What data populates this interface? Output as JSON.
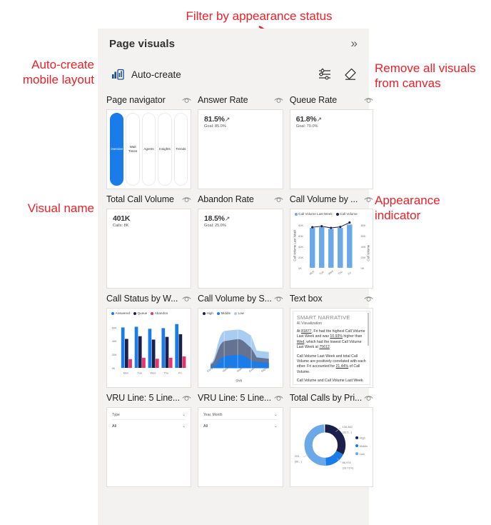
{
  "annotations": [
    {
      "id": "filter-note",
      "text": "Filter by appearance status"
    },
    {
      "id": "auto-create-note",
      "text": "Auto-create\nmobile layout"
    },
    {
      "id": "remove-visuals-note",
      "text": "Remove all visuals\nfrom canvas"
    },
    {
      "id": "visual-name-note",
      "text": "Visual name"
    },
    {
      "id": "appearance-note",
      "text": "Appearance\nindicator"
    }
  ],
  "pane": {
    "title": "Page visuals",
    "collapse_icon": "chevron-double-right-icon",
    "toolbar": {
      "auto_create_label": "Auto-create",
      "auto_create_icon": "mobile-chart-icon",
      "filter_icon": "filter-sliders-icon",
      "remove_icon": "eraser-icon"
    },
    "accent_color": "#1a7ce8",
    "annotation_color": "#ec2028",
    "panel_color": "#f3f2f1"
  },
  "visuals": [
    {
      "title": "Page navigator",
      "type": "page-navigator",
      "eye_icon": "eye-visible-icon",
      "tabs": [
        "Overview",
        "Wait Times",
        "Agents",
        "Insights",
        "Trends"
      ],
      "active_tab": "Overview"
    },
    {
      "title": "Answer Rate",
      "type": "kpi",
      "eye_icon": "eye-visible-icon",
      "value": "81.5%",
      "goal": "Goal: 85.0%"
    },
    {
      "title": "Queue Rate",
      "type": "kpi",
      "eye_icon": "eye-visible-icon",
      "value": "61.8%",
      "goal": "Goal: 70.0%"
    },
    {
      "title": "Total Call Volume",
      "type": "kpi",
      "eye_icon": "eye-visible-icon",
      "value": "401K",
      "goal": "Calls: 8K"
    },
    {
      "title": "Abandon Rate",
      "type": "kpi",
      "eye_icon": "eye-visible-icon",
      "value": "18.5%",
      "goal": "Goal: 25.0%"
    },
    {
      "title": "Call Volume by ...",
      "type": "combo",
      "eye_icon": "eye-visible-icon"
    },
    {
      "title": "Call Status by W...",
      "type": "clustered-column",
      "eye_icon": "eye-visible-icon"
    },
    {
      "title": "Call Volume by S...",
      "type": "stacked-area",
      "eye_icon": "eye-visible-icon"
    },
    {
      "title": "Text box",
      "type": "smart-narrative",
      "eye_icon": "eye-visible-icon"
    },
    {
      "title": "VRU Line: 5 Line...",
      "type": "slicer",
      "eye_icon": "eye-visible-icon",
      "field": "Type",
      "value": "All",
      "chevron_icon": "chevron-down-icon"
    },
    {
      "title": "VRU Line: 5 Line...",
      "type": "slicer",
      "eye_icon": "eye-visible-icon",
      "field": "Year, Month",
      "value": "All",
      "chevron_icon": "chevron-down-icon"
    },
    {
      "title": "Total Calls by Pri...",
      "type": "donut",
      "eye_icon": "eye-visible-icon"
    }
  ],
  "narrative": {
    "heading": "SMART NARRATIVE",
    "subheading": "AI Visualization",
    "p1_pre": "At ",
    "p1_v1": "81877",
    "p1_mid": ", Fri had the highest Call Volume Last Week and was ",
    "p1_v2": "10.93%",
    "p1_mid2": " higher than ",
    "p1_v3": "Wed",
    "p1_mid3": ", which had the lowest Call Volume Last Week at ",
    "p1_v4": "75612",
    "p1_end": ".",
    "p2_pre": "Call Volume Last Week and total Call Volume are positively correlated with each other. Fri accounted for ",
    "p2_v1": "21.44%",
    "p2_end": " of Call Volume.",
    "p3": "Call Volume and Call Volume Last Week"
  },
  "chart_data": [
    {
      "id": "call-volume-by-day",
      "type": "bar",
      "title": "Call Volume by ...",
      "categories": [
        "Mon",
        "Tue",
        "Wed",
        "Thu",
        "Fri"
      ],
      "series": [
        {
          "name": "Call Volume Last Week",
          "kind": "column",
          "color": "#6ba8e8",
          "values": [
            77000,
            78000,
            75612,
            77500,
            81877
          ]
        },
        {
          "name": "Call Volume",
          "kind": "line",
          "color": "#1b1f49",
          "values": [
            77500,
            79000,
            76000,
            78000,
            84000
          ]
        }
      ],
      "ylabel": "Call Volume Last Week",
      "y2label": "Call Volume",
      "yticks": [
        "0K",
        "20K",
        "40K",
        "60K",
        "80K"
      ],
      "y2ticks": [
        "0K",
        "20K",
        "40K",
        "60K",
        "80K"
      ],
      "ylim": [
        0,
        90000
      ],
      "legend_position": "top"
    },
    {
      "id": "call-status-by-weekday",
      "type": "bar",
      "title": "Call Status by W...",
      "categories": [
        "Mon",
        "Tue",
        "Wed",
        "Thu",
        "Fri"
      ],
      "series": [
        {
          "name": "Answered",
          "color": "#1a7ce8",
          "values": [
            58000,
            59000,
            57000,
            58000,
            62000
          ]
        },
        {
          "name": "Queue",
          "color": "#1b1f49",
          "values": [
            38000,
            42000,
            37000,
            41000,
            45000
          ]
        },
        {
          "name": "Abandon",
          "color": "#e8336d",
          "values": [
            13000,
            15000,
            13500,
            15000,
            16000
          ]
        }
      ],
      "ylabel": "",
      "yticks": [
        "0K",
        "20K",
        "40K",
        "60K"
      ],
      "ylim": [
        0,
        68000
      ],
      "legend_position": "top"
    },
    {
      "id": "call-volume-by-shift",
      "type": "area",
      "title": "Call Volume by S...",
      "xlabel": "Shift",
      "categories": [
        "Early Morning",
        "Morning",
        "Noon",
        "Evening",
        "Night"
      ],
      "series": [
        {
          "name": "High",
          "color": "#1b1f49",
          "values": [
            8,
            44,
            52,
            40,
            10
          ]
        },
        {
          "name": "Middle",
          "color": "#1a7ce8",
          "values": [
            14,
            22,
            26,
            22,
            14
          ]
        },
        {
          "name": "Low",
          "color": "#a9cdf2",
          "values": [
            10,
            46,
            52,
            44,
            20
          ]
        }
      ],
      "legend_position": "top"
    },
    {
      "id": "total-calls-by-priority",
      "type": "pie",
      "title": "Total Calls by Pri...",
      "labels": [
        "High",
        "Middle",
        "Low"
      ],
      "colors": [
        "#1b1f49",
        "#1a7ce8",
        "#6ba8e8"
      ],
      "values": [
        130382,
        66978,
        203000
      ],
      "value_labels": [
        "130,382",
        "66,978",
        "203..."
      ],
      "percent_labels": [
        "(32.5...)",
        "(16.71%)",
        "(50...)"
      ],
      "legend_position": "right",
      "donut": true
    }
  ]
}
